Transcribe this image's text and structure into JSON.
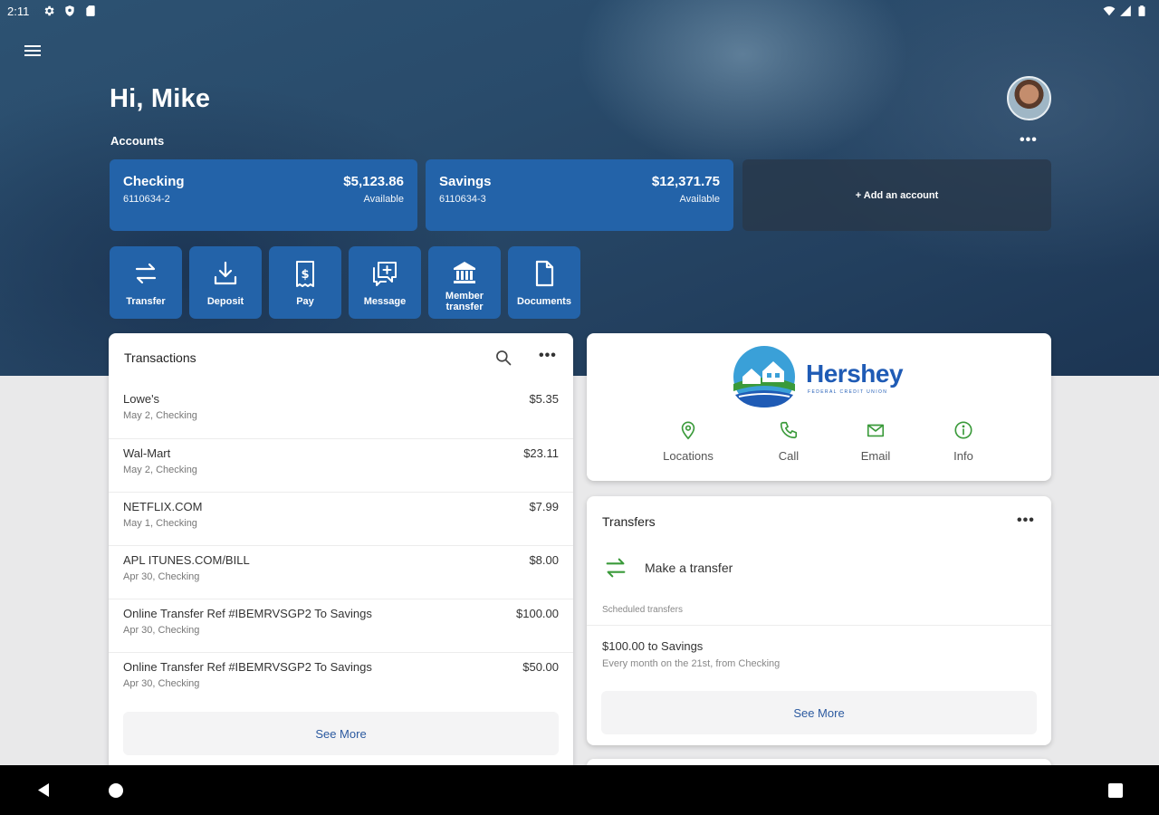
{
  "status_bar": {
    "time": "2:11"
  },
  "header": {
    "greeting": "Hi, Mike",
    "accounts_label": "Accounts",
    "more_label": "•••"
  },
  "accounts": [
    {
      "name": "Checking",
      "number": "6110634-2",
      "balance": "$5,123.86",
      "balance_label": "Available"
    },
    {
      "name": "Savings",
      "number": "6110634-3",
      "balance": "$12,371.75",
      "balance_label": "Available"
    }
  ],
  "add_account_label": "+ Add an account",
  "quick_actions": [
    {
      "label": "Transfer",
      "icon": "transfer-icon"
    },
    {
      "label": "Deposit",
      "icon": "deposit-icon"
    },
    {
      "label": "Pay",
      "icon": "pay-icon"
    },
    {
      "label": "Message",
      "icon": "message-icon"
    },
    {
      "label_line1": "Member",
      "label_line2": "transfer",
      "icon": "bank-icon"
    },
    {
      "label": "Documents",
      "icon": "document-icon"
    }
  ],
  "transactions": {
    "title": "Transactions",
    "more_label": "•••",
    "items": [
      {
        "name": "Lowe's",
        "detail": "May 2, Checking",
        "amount": "$5.35"
      },
      {
        "name": "Wal-Mart",
        "detail": "May 2, Checking",
        "amount": "$23.11"
      },
      {
        "name": "NETFLIX.COM",
        "detail": "May 1, Checking",
        "amount": "$7.99"
      },
      {
        "name": "APL ITUNES.COM/BILL",
        "detail": "Apr 30, Checking",
        "amount": "$8.00"
      },
      {
        "name": "Online Transfer Ref #IBEMRVSGP2 To Savings",
        "detail": "Apr 30, Checking",
        "amount": "$100.00"
      },
      {
        "name": "Online Transfer Ref #IBEMRVSGP2 To Savings",
        "detail": "Apr 30, Checking",
        "amount": "$50.00"
      }
    ],
    "see_more": "See More"
  },
  "credit_union": {
    "name": "Hershey",
    "subtitle": "FEDERAL CREDIT UNION",
    "actions": [
      {
        "label": "Locations",
        "icon": "location-pin-icon"
      },
      {
        "label": "Call",
        "icon": "phone-icon"
      },
      {
        "label": "Email",
        "icon": "email-icon"
      },
      {
        "label": "Info",
        "icon": "info-icon"
      }
    ],
    "accent_color": "#3a9a3a",
    "brand_color": "#1f5bb5"
  },
  "transfers": {
    "title": "Transfers",
    "more_label": "•••",
    "make_transfer": "Make a transfer",
    "scheduled_label": "Scheduled transfers",
    "scheduled": [
      {
        "title": "$100.00 to Savings",
        "subtitle": "Every month on the 21st, from Checking"
      }
    ],
    "see_more": "See More"
  },
  "colors": {
    "primary": "#2363a9",
    "link": "#2c5aa0"
  }
}
